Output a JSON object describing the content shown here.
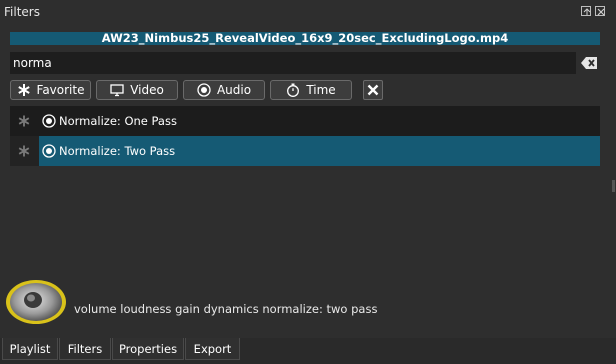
{
  "panel": {
    "title": "Filters"
  },
  "clip": {
    "name": "AW23_Nimbus25_RevealVideo_16x9_20sec_ExcludingLogo.mp4"
  },
  "search": {
    "value": "norma",
    "placeholder": ""
  },
  "filter_buttons": {
    "favorite": "Favorite",
    "video": "Video",
    "audio": "Audio",
    "time": "Time"
  },
  "results": [
    {
      "label": "Normalize: One Pass",
      "selected": false
    },
    {
      "label": "Normalize: Two Pass",
      "selected": true
    }
  ],
  "description": {
    "text": "volume loudness gain dynamics normalize: two pass"
  },
  "tabs": {
    "playlist": "Playlist",
    "filters": "Filters",
    "properties": "Properties",
    "export": "Export"
  },
  "colors": {
    "selection": "#155a74",
    "background": "#2e2e2e"
  }
}
